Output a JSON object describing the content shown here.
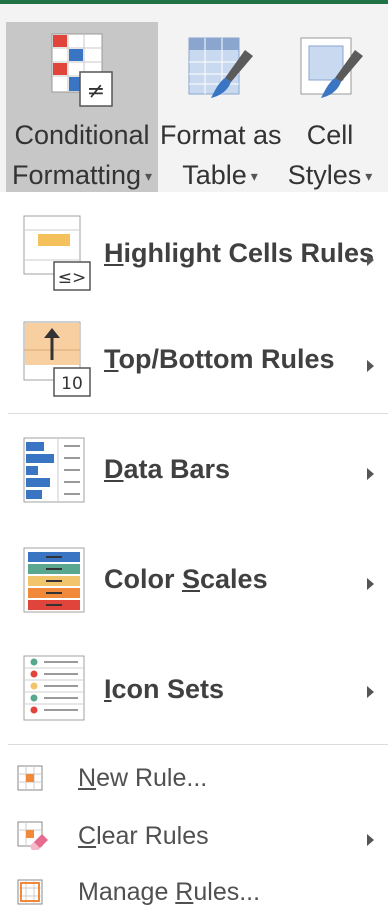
{
  "ribbon": {
    "conditional_formatting": {
      "line1": "Conditional",
      "line2": "Formatting"
    },
    "format_as_table": {
      "line1": "Format as",
      "line2": "Table"
    },
    "cell_styles": {
      "line1": "Cell",
      "line2": "Styles"
    },
    "caret": "▾"
  },
  "menu": {
    "highlight_cells_rules": {
      "label_key": "H",
      "label_rest": "ighlight Cells Rules",
      "icon_text": "≤>"
    },
    "top_bottom_rules": {
      "label_key": "T",
      "label_rest": "op/Bottom Rules",
      "icon_text": "10"
    },
    "data_bars": {
      "label_key": "D",
      "label_rest": "ata Bars"
    },
    "color_scales": {
      "label_pre": "Color ",
      "label_key": "S",
      "label_rest": "cales"
    },
    "icon_sets": {
      "label_key": "I",
      "label_rest": "con Sets"
    },
    "new_rule": {
      "label_key": "N",
      "label_rest": "ew Rule..."
    },
    "clear_rules": {
      "label_key": "C",
      "label_rest": "lear Rules"
    },
    "manage_rules": {
      "label_pre": "Manage ",
      "label_key": "R",
      "label_rest": "ules..."
    }
  },
  "colors": {
    "excel_green": "#217346",
    "accent_blue": "#3a75c4",
    "accent_red": "#e0443b",
    "accent_orange": "#f4b183",
    "accent_teal": "#5aa78f"
  }
}
